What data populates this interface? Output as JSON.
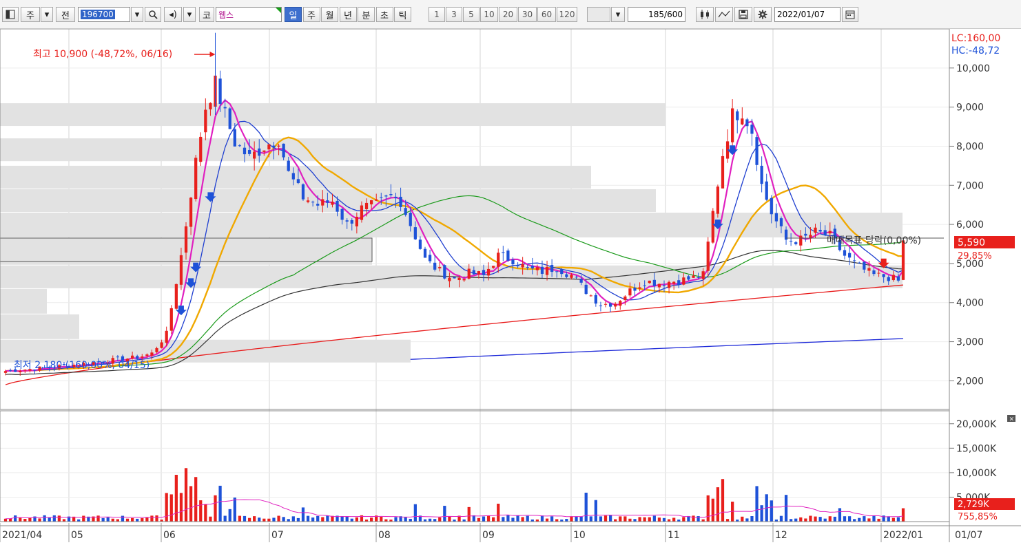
{
  "toolbar": {
    "market_labels": [
      "주",
      "전"
    ],
    "code_value": "196700",
    "stock_initial": "코",
    "stock_name": "웹스",
    "period_buttons": [
      "일",
      "주",
      "월",
      "년",
      "분",
      "초",
      "틱"
    ],
    "selected_period": "일",
    "interval_buttons": [
      "1",
      "3",
      "5",
      "10",
      "20",
      "30",
      "60",
      "120"
    ],
    "count_value": "185",
    "count_total": "/600",
    "date_value": "2022/01/07"
  },
  "colors": {
    "up": "#e8201c",
    "down": "#1e52d8",
    "ma5": "#e020c0",
    "ma10": "#1f3fd0",
    "ma20": "#f0a800",
    "ma60": "#1a9a1a",
    "ma120": "#333333",
    "ma240": "#e81818",
    "ma480": "#1c28d8",
    "profile_band": "#e2e2e2"
  },
  "price_panel": {
    "lc_label": "LC:160,00",
    "hc_label": "HC:-48,72",
    "high_annotation": "최고 10,900 (-48,72%, 06/16)",
    "low_annotation": "최저 2,180 (160,00%, 04/15)",
    "target_label": "매매목표 당락(0,00%)",
    "current_price": "5,590",
    "current_change": "29,85%"
  },
  "volume_panel": {
    "current_volume": "2,729K",
    "volume_change": "755,85%"
  },
  "x_axis_labels": [
    "2021/04",
    "05",
    "06",
    "07",
    "08",
    "09",
    "10",
    "11",
    "12",
    "2022/01"
  ],
  "x_axis_corner": "01/07",
  "chart_data": [
    {
      "type": "candlestick",
      "title": "",
      "y_ticks": [
        "10,000",
        "9,000",
        "8,000",
        "7,000",
        "6,000",
        "5,000",
        "4,000",
        "3,000",
        "2,000"
      ],
      "ylim": [
        1250,
        11000
      ],
      "grid": true,
      "monthly_close": [
        {
          "month": "2021/04",
          "value": 2400
        },
        {
          "month": "05",
          "value": 2700
        },
        {
          "month": "06",
          "value": 8000
        },
        {
          "month": "07",
          "value": 6500
        },
        {
          "month": "08",
          "value": 4700
        },
        {
          "month": "09",
          "value": 4900
        },
        {
          "month": "10",
          "value": 4500
        },
        {
          "month": "11",
          "value": 7200
        },
        {
          "month": "12",
          "value": 4900
        },
        {
          "month": "2022/01",
          "value": 5590
        }
      ],
      "high": {
        "value": 10900,
        "date": "06/16",
        "change_pct": -48.72
      },
      "low": {
        "value": 2180,
        "date": "04/15",
        "change_pct": 160.0
      },
      "last_close": 5590
    },
    {
      "type": "bar",
      "title": "",
      "y_ticks": [
        "20,000K",
        "15,000K",
        "10,000K",
        "5,000K"
      ],
      "ylim": [
        0,
        22500
      ],
      "unit": "K",
      "last_volume_k": 2729
    }
  ]
}
